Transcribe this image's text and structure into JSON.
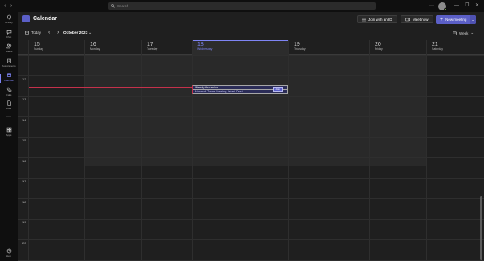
{
  "titlebar": {
    "back_glyph": "‹",
    "forward_glyph": "›",
    "search_placeholder": "Search",
    "more_glyph": "···",
    "minimize_glyph": "—",
    "restore_glyph": "❐",
    "close_glyph": "✕"
  },
  "rail": {
    "items": [
      {
        "label": "Activity",
        "icon": "bell-icon"
      },
      {
        "label": "Chat",
        "icon": "chat-icon"
      },
      {
        "label": "Teams",
        "icon": "teams-icon"
      },
      {
        "label": "Assignments",
        "icon": "assignments-icon"
      },
      {
        "label": "Calendar",
        "icon": "calendar-icon",
        "active": true
      },
      {
        "label": "Calls",
        "icon": "phone-icon"
      },
      {
        "label": "Files",
        "icon": "file-icon"
      },
      {
        "label": "···",
        "icon": "more-icon"
      },
      {
        "label": "Apps",
        "icon": "apps-icon"
      }
    ],
    "help": "Help"
  },
  "header": {
    "title": "Calendar",
    "join_with_id": "Join with an ID",
    "meet_now": "Meet now",
    "new_meeting": "New meeting",
    "caret": "⌄"
  },
  "toolbar": {
    "today": "Today",
    "prev": "‹",
    "next": "›",
    "month": "October 2023",
    "month_caret": "⌄",
    "view": "Week",
    "view_caret": "⌄"
  },
  "days": [
    {
      "num": "15",
      "name": "Sunday"
    },
    {
      "num": "16",
      "name": "Monday"
    },
    {
      "num": "17",
      "name": "Tuesday"
    },
    {
      "num": "18",
      "name": "Wednesday",
      "today": true
    },
    {
      "num": "19",
      "name": "Thursday"
    },
    {
      "num": "20",
      "name": "Friday"
    },
    {
      "num": "21",
      "name": "Saturday"
    }
  ],
  "hours": [
    "12",
    "13",
    "14",
    "15",
    "16",
    "17",
    "18",
    "19",
    "20",
    "21"
  ],
  "event": {
    "title": "Weekly discussion",
    "subtitle": "Microsoft Teams Meeting; Ishani Desai",
    "join_label": "Join"
  },
  "colors": {
    "accent": "#5b5fc7",
    "today_accent": "#7f85f5",
    "now_line": "#c4314b"
  }
}
